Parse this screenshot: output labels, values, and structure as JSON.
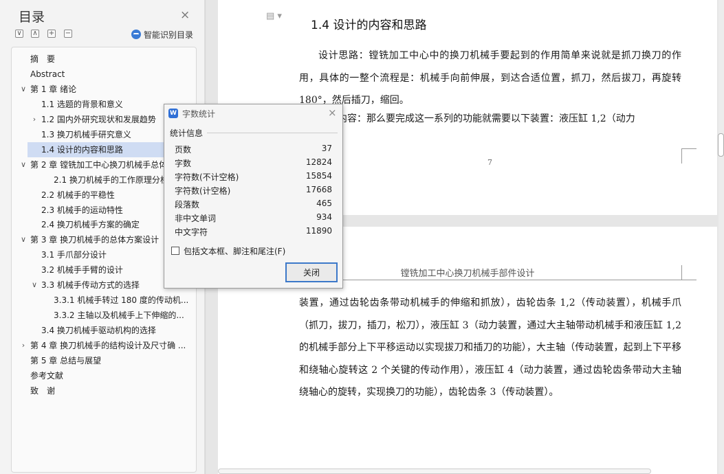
{
  "sidebar": {
    "title": "目录",
    "close": "×",
    "controls": [
      "∨",
      "∧",
      "+",
      "−"
    ],
    "smart_label": "智能识别目录",
    "toc": [
      {
        "label": "摘　要",
        "level": 0,
        "arrow": ""
      },
      {
        "label": "Abstract",
        "level": 0,
        "arrow": ""
      },
      {
        "label": "第 1 章  绪论",
        "level": 0,
        "arrow": "∨"
      },
      {
        "label": "1.1 选题的背景和意义",
        "level": 1,
        "arrow": ""
      },
      {
        "label": "1.2 国内外研究现状和发展趋势",
        "level": 1,
        "arrow": "›"
      },
      {
        "label": "1.3  换刀机械手研究意义",
        "level": 1,
        "arrow": ""
      },
      {
        "label": "1.4  设计的内容和思路",
        "level": 1,
        "arrow": "",
        "selected": true
      },
      {
        "label": "第 2 章  镗铣加工中心换刀机械手总体",
        "level": 0,
        "arrow": "∨"
      },
      {
        "label": "2.1  换刀机械手的工作原理分析",
        "level": 2,
        "arrow": ""
      },
      {
        "label": "2.2  机械手的平稳性",
        "level": 1,
        "arrow": ""
      },
      {
        "label": "2.3  机械手的运动特性",
        "level": 1,
        "arrow": ""
      },
      {
        "label": "2.4  换刀机械手方案的确定",
        "level": 1,
        "arrow": ""
      },
      {
        "label": "第 3 章  换刀机械手的总体方案设计",
        "level": 0,
        "arrow": "∨"
      },
      {
        "label": "3.1 手爪部分设计",
        "level": 1,
        "arrow": ""
      },
      {
        "label": "3.2  机械手手臂的设计",
        "level": 1,
        "arrow": ""
      },
      {
        "label": "3.3  机械手传动方式的选择",
        "level": 1,
        "arrow": "∨"
      },
      {
        "label": "3.3.1 机械手转过 180 度的传动机...",
        "level": 2,
        "arrow": ""
      },
      {
        "label": "3.3.2  主轴以及机械手上下伸缩的...",
        "level": 2,
        "arrow": ""
      },
      {
        "label": "3.4  换刀机械手驱动机构的选择",
        "level": 1,
        "arrow": ""
      },
      {
        "label": "第 4 章  换刀机械手的结构设计及尺寸确 ...",
        "level": 0,
        "arrow": "›"
      },
      {
        "label": "第 5 章  总结与展望",
        "level": 0,
        "arrow": ""
      },
      {
        "label": "参考文献",
        "level": 0,
        "arrow": ""
      },
      {
        "label": "致　谢",
        "level": 0,
        "arrow": ""
      }
    ]
  },
  "document": {
    "heading": "1.4  设计的内容和思路",
    "para1": "设计思路：镗铣加工中心中的换刀机械手要起到的作用简单来说就是抓刀换刀的作用，具体的一整个流程是：机械手向前伸展，到达合适位置，抓刀，然后拔刀，再旋转 180°，然后插刀，缩回。",
    "para2": "设计内容：那么要完成这一系列的功能就需要以下装置：液压缸 1,2（动力",
    "page_number": "7",
    "running_header": "镗铣加工中心换刀机械手部件设计",
    "para3": "装置，通过齿轮齿条带动机械手的伸缩和抓放），齿轮齿条 1,2（传动装置），机械手爪（抓刀，拔刀，插刀，松刀），液压缸 3（动力装置，通过大主轴带动机械手和液压缸 1,2 的机械手部分上下平移运动以实现拔刀和插刀的功能），大主轴（传动装置，起到上下平移和绕轴心旋转这 2 个关键的传动作用），液压缸 4（动力装置，通过齿轮齿条带动大主轴绕轴心的旋转，实现换刀的功能），齿轮齿条 3（传动装置）。"
  },
  "dialog": {
    "icon": "W",
    "title": "字数统计",
    "close": "×",
    "section": "统计信息",
    "stats": [
      {
        "label": "页数",
        "value": "37"
      },
      {
        "label": "字数",
        "value": "12824"
      },
      {
        "label": "字符数(不计空格)",
        "value": "15854"
      },
      {
        "label": "字符数(计空格)",
        "value": "17668"
      },
      {
        "label": "段落数",
        "value": "465"
      },
      {
        "label": "非中文单词",
        "value": "934"
      },
      {
        "label": "中文字符",
        "value": "11890"
      }
    ],
    "checkbox_label": "包括文本框、脚注和尾注(F)",
    "checkbox_checked": false,
    "button_label": "关闭"
  },
  "colors": {
    "accent": "#3c78c9",
    "selected_bg": "#cfdcf3"
  }
}
